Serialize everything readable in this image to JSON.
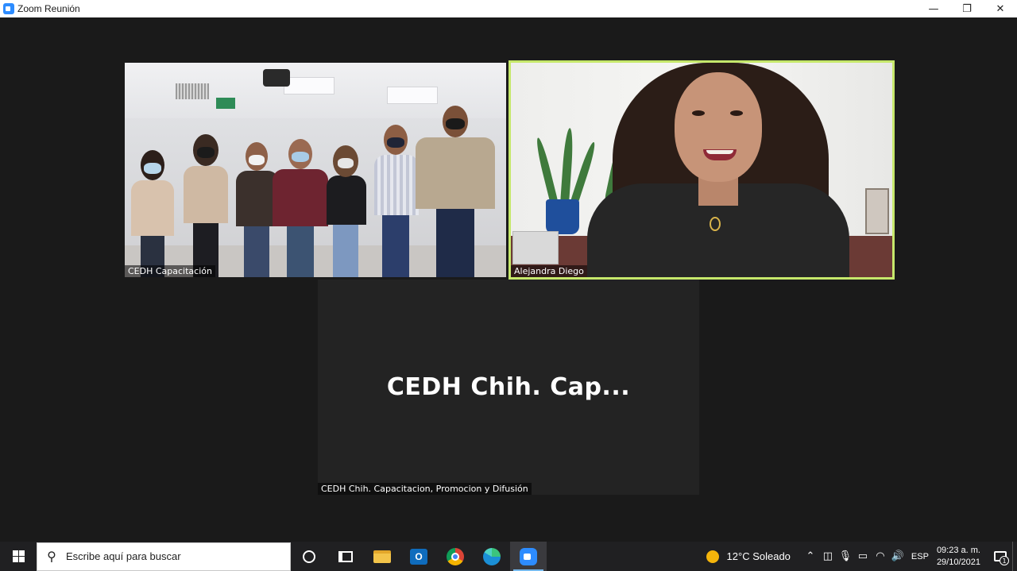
{
  "window": {
    "title": "Zoom Reunión",
    "controls": {
      "minimize": "—",
      "restore": "❐",
      "close": "✕"
    }
  },
  "meeting": {
    "tiles": [
      {
        "label": "CEDH Capacitación"
      },
      {
        "label": "Alejandra Diego",
        "active_speaker": true,
        "highlight_color": "#c6e86b"
      },
      {
        "label": "CEDH Chih. Capacitacion, Promocion y Difusión",
        "display_name": "CEDH Chih. Cap..."
      }
    ]
  },
  "taskbar": {
    "search_placeholder": "Escribe aquí para buscar",
    "apps": [
      "cortana-icon",
      "task-view-icon",
      "file-explorer-icon",
      "outlook-icon",
      "chrome-icon",
      "edge-icon",
      "zoom-icon"
    ],
    "weather": "12°C  Soleado",
    "language": "ESP",
    "time": "09:23 a. m.",
    "date": "29/10/2021",
    "notification_count": "1"
  }
}
